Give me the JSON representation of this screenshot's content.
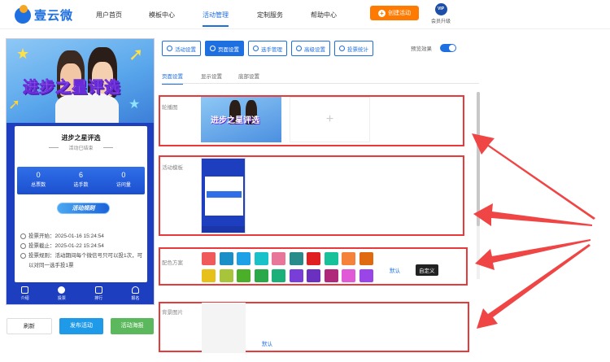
{
  "header": {
    "logo_text": "壹云微",
    "nav": [
      "用户首页",
      "模板中心",
      "活动管理",
      "定制服务",
      "帮助中心"
    ],
    "active_nav": "活动管理",
    "create_label": "创建活动",
    "vip_badge": "VIP",
    "vip_label": "会员升级"
  },
  "preview": {
    "banner_title": "进步之星评选",
    "activity_title": "进步之星评选",
    "status": "活动已结束",
    "stats": [
      {
        "num": "0",
        "label": "总票数"
      },
      {
        "num": "6",
        "label": "选手数"
      },
      {
        "num": "0",
        "label": "访问量"
      }
    ],
    "rules_label": "活动规则",
    "info": [
      "投票开始：2025-01-16 15:24:54",
      "投票截止：2025-01-22 15:24:54",
      "投票规则：活动期间每个微信号只可以投1次，可以对同一选手投1票"
    ],
    "tabbar": [
      "介绍",
      "投票",
      "排行",
      "报名"
    ]
  },
  "actions": {
    "refresh": "刷新",
    "publish": "发布活动",
    "poster": "活动海报"
  },
  "toolbar": {
    "buttons": [
      "活动设置",
      "页面设置",
      "选手管理",
      "高级设置",
      "投票统计"
    ],
    "active": "页面设置",
    "preview_label": "预览效果"
  },
  "subtabs": [
    "页面设置",
    "显示设置",
    "底部设置"
  ],
  "sections": {
    "carousel_label": "轮播图",
    "carousel_thumb_text": "进步之星评选",
    "carousel_add": "+",
    "template_label": "活动模板",
    "color_label": "配色方案",
    "color_default": "默认",
    "color_custom": "自定义",
    "bg_label": "背景图片",
    "bg_default": "默认"
  },
  "colors": {
    "accent": "#1e6fe0",
    "highlight": "#e83a3a",
    "swatches_row1": [
      "#f05a5a",
      "#1a8fc7",
      "#1ea0e6",
      "#19c1c9",
      "#e8759a",
      "#2a8b8b",
      "#e02020",
      "#17c29a",
      "#f5823a",
      "#e06a10"
    ],
    "swatches_row2": [
      "#e8c01a",
      "#a8c43a",
      "#4caf2a",
      "#2aa84a",
      "#1bb07a",
      "#7a3ed8",
      "#6a30c0",
      "#b0287a",
      "#e05ad8",
      "#9a45e8"
    ]
  }
}
